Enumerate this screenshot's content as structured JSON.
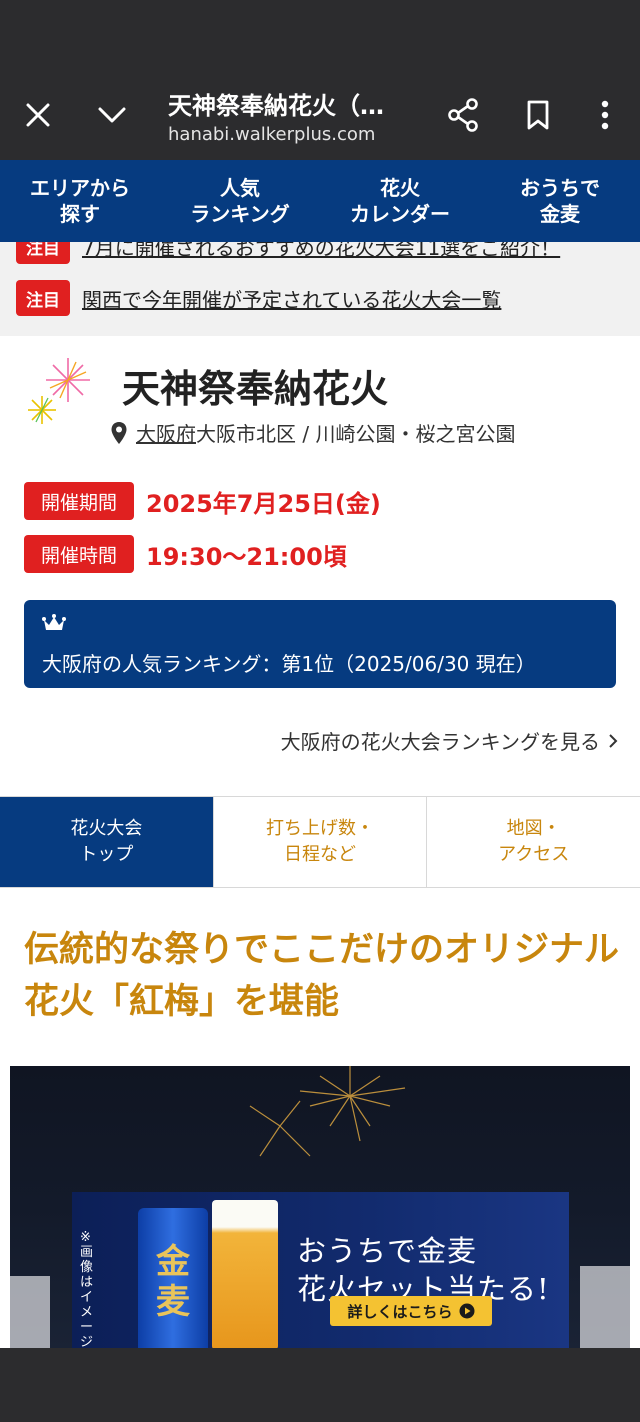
{
  "browser": {
    "title": "天神祭奉納花火（…",
    "url": "hanabi.walkerplus.com",
    "icons": [
      "close-icon",
      "chevron-down-icon",
      "share-icon",
      "bookmark-icon",
      "more-vert-icon"
    ]
  },
  "site_nav": {
    "items": [
      {
        "label": "エリアから\n探す"
      },
      {
        "label": "人気\nランキング"
      },
      {
        "label": "花火\nカレンダー"
      },
      {
        "label": "おうちで\n金麦"
      }
    ]
  },
  "notices": [
    {
      "badge": "注目",
      "text": "7月に開催されるおすすめの花火大会11選をご紹介！"
    },
    {
      "badge": "注目",
      "text": "関西で今年開催が予定されている花火大会一覧"
    }
  ],
  "event": {
    "title": "天神祭奉納花火",
    "prefecture": "大阪府",
    "location_rest": "大阪市北区 / 川崎公園・桜之宮公園",
    "period_label": "開催期間",
    "period_value": "2025年7月25日(金)",
    "time_label": "開催時間",
    "time_value": "19:30〜21:00頃"
  },
  "ranking": {
    "text": "大阪府の人気ランキング：第1位（2025/06/30 現在）",
    "link": "大阪府の花火大会ランキングを見る"
  },
  "tabs": [
    {
      "label": "花火大会\nトップ",
      "active": true
    },
    {
      "label": "打ち上げ数・\n日程など",
      "active": false
    },
    {
      "label": "地図・\nアクセス",
      "active": false
    }
  ],
  "headline": "伝統的な祭りでここだけのオリジナル花火「紅梅」を堪能",
  "ad": {
    "line1": "おうちで金麦",
    "line2": "花火セット当たる!",
    "button": "詳しくはこちら",
    "note": "※画像はイメージです",
    "can_text": "金麦"
  },
  "colors": {
    "nav_blue": "#063b80",
    "accent_red": "#e02020",
    "gold": "#c8860d"
  }
}
